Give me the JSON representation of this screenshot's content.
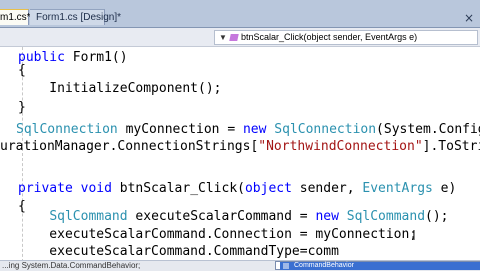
{
  "tabs": [
    {
      "label": "m1.cs*"
    },
    {
      "label": "Form1.cs [Design]*"
    }
  ],
  "close_glyph": "×",
  "navigation": {
    "member_label": "btnScalar_Click(object sender, EventArgs e)"
  },
  "code_lines": [
    {
      "parts": [
        {
          "c": "kw",
          "t": "public "
        },
        {
          "c": "",
          "t": "Form1()"
        }
      ]
    },
    {
      "parts": [
        {
          "c": "",
          "t": "{"
        }
      ]
    },
    {
      "parts": [
        {
          "c": "",
          "t": "    InitializeComponent();"
        }
      ]
    },
    {
      "parts": [
        {
          "c": "",
          "t": "}"
        }
      ]
    },
    {
      "parts": [
        {
          "c": "",
          "t": ""
        }
      ]
    },
    {
      "parts": [
        {
          "c": "ty",
          "t": "SqlConnection"
        },
        {
          "c": "",
          "t": " myConnection = "
        },
        {
          "c": "kw",
          "t": "new "
        },
        {
          "c": "ty",
          "t": "SqlConnection"
        },
        {
          "c": "",
          "t": "(System.Configu"
        }
      ]
    },
    {
      "parts": [
        {
          "c": "",
          "t": "urationManager.ConnectionStrings["
        },
        {
          "c": "st",
          "t": "\"NorthwindConnection\""
        },
        {
          "c": "",
          "t": "].ToString"
        }
      ]
    },
    {
      "parts": [
        {
          "c": "",
          "t": ""
        }
      ]
    },
    {
      "parts": [
        {
          "c": "kw",
          "t": "private void "
        },
        {
          "c": "",
          "t": "btnScalar_Click("
        },
        {
          "c": "kw",
          "t": "object"
        },
        {
          "c": "",
          "t": " sender, "
        },
        {
          "c": "ty",
          "t": "EventArgs"
        },
        {
          "c": "",
          "t": " e)"
        }
      ]
    },
    {
      "parts": [
        {
          "c": "",
          "t": "{"
        }
      ]
    },
    {
      "parts": [
        {
          "c": "",
          "t": "    "
        },
        {
          "c": "ty",
          "t": "SqlCommand"
        },
        {
          "c": "",
          "t": " executeScalarCommand = "
        },
        {
          "c": "kw",
          "t": "new "
        },
        {
          "c": "ty",
          "t": "SqlCommand"
        },
        {
          "c": "",
          "t": "();"
        }
      ]
    },
    {
      "parts": [
        {
          "c": "",
          "t": "    executeScalarCommand.Connection = myConnection;"
        }
      ]
    },
    {
      "parts": [
        {
          "c": "",
          "t": "    executeScalarCommand.CommandType=comm"
        }
      ]
    }
  ],
  "status_text": "...ing System.Data.CommandBehavior;",
  "intellisense": {
    "selected_item": "CommandBehavior"
  },
  "cursor_glyph": "I"
}
